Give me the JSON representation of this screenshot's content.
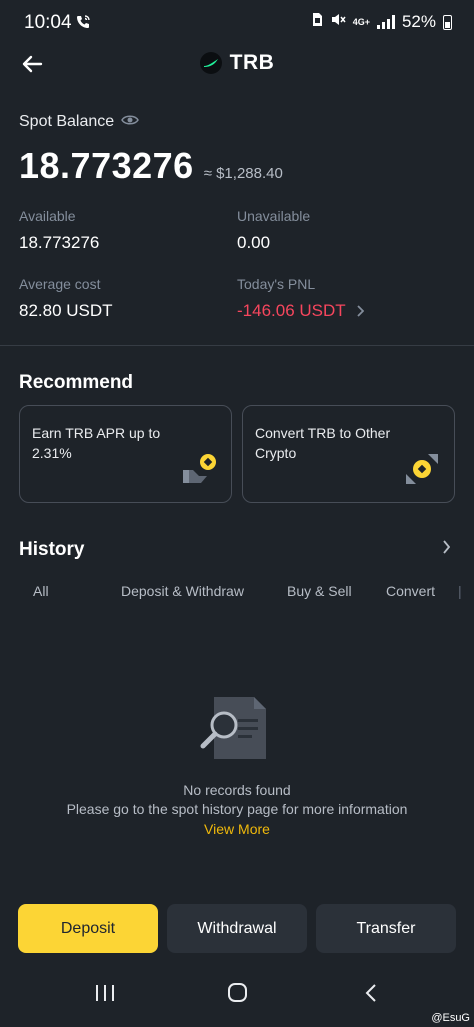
{
  "status_bar": {
    "time": "10:04",
    "network_top": "4G+",
    "battery": "52%"
  },
  "header": {
    "title": "TRB",
    "back_icon": "arrow-left-icon",
    "coin_icon": "trb-logo"
  },
  "balance": {
    "label": "Spot Balance",
    "amount": "18.773276",
    "usd_value": "≈ $1,288.40"
  },
  "stats": {
    "available_label": "Available",
    "available_value": "18.773276",
    "unavailable_label": "Unavailable",
    "unavailable_value": "0.00",
    "avg_cost_label": "Average cost",
    "avg_cost_value": "82.80 USDT",
    "pnl_label": "Today's PNL",
    "pnl_value": "-146.06 USDT"
  },
  "recommend": {
    "title": "Recommend",
    "cards": [
      {
        "text": "Earn TRB APR up to 2.31%",
        "icon": "earn-icon"
      },
      {
        "text": "Convert TRB to Other Crypto",
        "icon": "convert-icon"
      }
    ]
  },
  "history": {
    "title": "History",
    "tabs": [
      "All",
      "Deposit & Withdraw",
      "Buy & Sell",
      "Convert"
    ],
    "empty_title": "No records found",
    "empty_desc": "Please go to the spot history page for more information",
    "view_more": "View More"
  },
  "actions": {
    "deposit": "Deposit",
    "withdrawal": "Withdrawal",
    "transfer": "Transfer"
  },
  "watermark": "@EsuG",
  "colors": {
    "background": "#1e2329",
    "accent": "#fcd535",
    "negative": "#f6465d",
    "secondary_button": "#2b3139"
  }
}
